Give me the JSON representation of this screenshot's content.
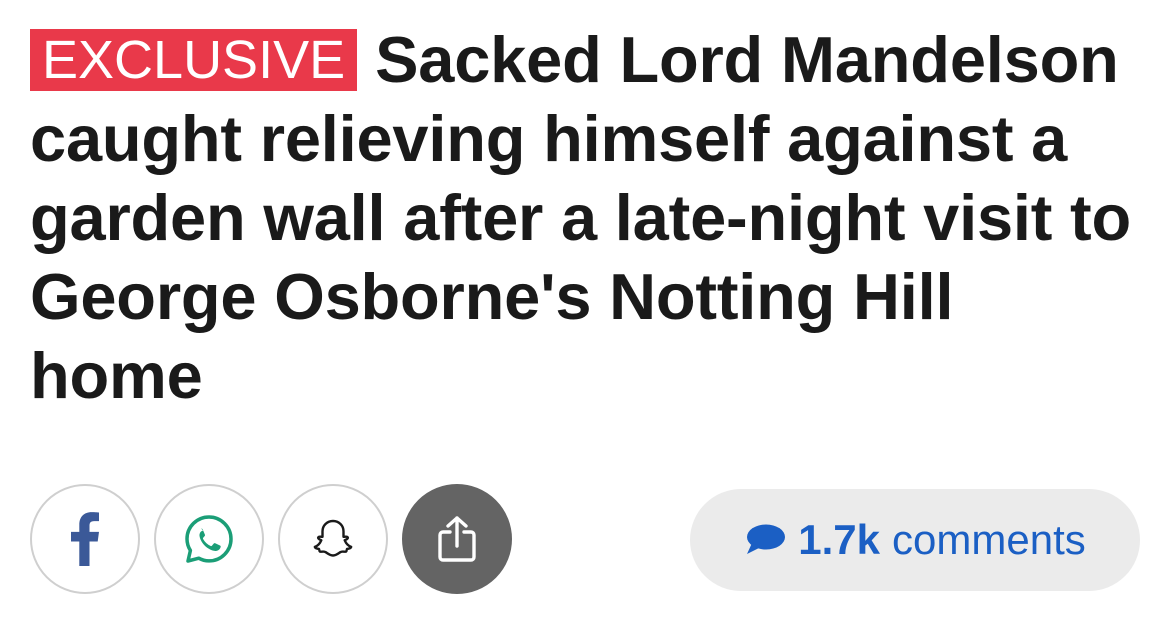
{
  "article": {
    "badge": "EXCLUSIVE",
    "title": "Sacked Lord Mandelson caught relieving himself against a garden wall after a late-night visit to George Osborne's Notting Hill home"
  },
  "share": {
    "buttons": [
      {
        "name": "facebook",
        "icon": "facebook-icon"
      },
      {
        "name": "whatsapp",
        "icon": "whatsapp-icon"
      },
      {
        "name": "snapchat",
        "icon": "snapchat-icon"
      },
      {
        "name": "share",
        "icon": "share-icon"
      }
    ]
  },
  "comments": {
    "count": "1.7k",
    "label": "comments",
    "icon": "comment-bubble-icon"
  },
  "colors": {
    "badge_bg": "#e9394a",
    "headline": "#1a1a1a",
    "facebook": "#3b5998",
    "whatsapp": "#1b9e77",
    "comments_text": "#1b5fc4",
    "comments_bg": "#ebebeb",
    "share_dark": "#646464"
  }
}
